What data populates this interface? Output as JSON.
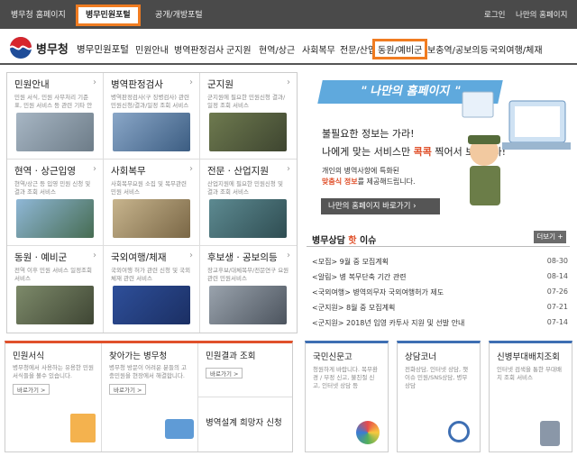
{
  "topbar": {
    "items": [
      "병무청 홈페이지",
      "병무민원포털",
      "공개/개방포털"
    ],
    "right": [
      "로그인",
      "나만의 홈페이지"
    ]
  },
  "header": {
    "logo_text": "병무청",
    "portal": "병무민원포털",
    "nav": [
      "민원안내",
      "병역판정검사",
      "군지원",
      "현역/상근",
      "사회복무",
      "전문/산업",
      "동원/예비군",
      "보충역/공보의등",
      "국외여행/체재"
    ]
  },
  "tiles": [
    {
      "title": "민원안내",
      "desc": "민원 서식, 민원 사무처리 기준표, 민원 서비스 등 관련 기타 안내"
    },
    {
      "title": "병역판정검사",
      "desc": "병역판정검사(구 징병검사) 관련 민원신청/결과/일정 조회 서비스"
    },
    {
      "title": "군지원",
      "desc": "군지원에 필요한 민원신청 결과/일정 조회 서비스"
    },
    {
      "title": "현역 · 상근입영",
      "desc": "현역/상근 등 입영 민원 신청 및 결과 조회 서비스"
    },
    {
      "title": "사회복무",
      "desc": "사회복무요원 소집 및 복무관련 민원 서비스"
    },
    {
      "title": "전문 · 산업지원",
      "desc": "산업지원에 필요한 민원신청 및 결과 조회 서비스"
    },
    {
      "title": "동원 · 예비군",
      "desc": "전역 이후 민원 서비스 일정조회 서비스"
    },
    {
      "title": "국외여행/체재",
      "desc": "국외여행 허가 관련 신청 및 국외체재 관련 서비스"
    },
    {
      "title": "후보생 · 공보의등",
      "desc": "장교후보/대체복무/전문연구 요원 관련 민원서비스"
    }
  ],
  "promo": {
    "ribbon": "\" 나만의 홈페이지 \"",
    "line1": "불필요한 정보는 가라!",
    "line2_a": "나에게 맞는 서비스만",
    "line2_b": "콕콕",
    "line2_c": "찍어서 보여준다!",
    "line3": "개인의 병역사항에 특화된",
    "line4_a": "맞춤식 정보",
    "line4_b": "를 제공해드립니다.",
    "button": "나만의 홈페이지 바로가기"
  },
  "issues": {
    "heading_a": "병무상담",
    "heading_b": "핫",
    "heading_c": "이슈",
    "more": "더보기 +",
    "items": [
      {
        "text": "<모집> 9월 중 모집계획",
        "date": "08-30"
      },
      {
        "text": "<알림> 병 복무단축 기간 관련",
        "date": "08-14"
      },
      {
        "text": "<국외여행> 병역의무자 국외여행허가 제도",
        "date": "07-26"
      },
      {
        "text": "<군지원> 8월 중 모집계획",
        "date": "07-21"
      },
      {
        "text": "<군지원> 2018년 입영 카투사 지원 및 선발 안내",
        "date": "07-14"
      }
    ]
  },
  "bottom": {
    "cards": [
      {
        "title": "민원서식",
        "desc": "병무청에서 사용하는 유용한 민원서식들을 볼수 있습니다.",
        "btn": "바로가기 >"
      },
      {
        "title": "찾아가는 병무청",
        "desc": "병무청 방문이 어려운 분들의 고충민원을 현장에서 해결합니다.",
        "btn": "바로가기 >"
      },
      {
        "title": "민원결과 조회",
        "btn": "바로가기 >"
      },
      {
        "title": "병역설계 희망자 신청"
      }
    ],
    "right": [
      {
        "title": "국민신문고",
        "desc": "청원하게 바랍니다. 복무환경 / 부정 신고, 불친절 신고, 인터넷 상담 등"
      },
      {
        "title": "상담코너",
        "desc": "전화상담, 인터넷 상담, 챗이슈 민원/SNS상담, 병무상담"
      },
      {
        "title": "신병부대배치조회",
        "desc": "인터넷 검색을 통한 부대배치 조회 서비스"
      }
    ]
  },
  "colors": {
    "highlight": "#f07c21",
    "topbar": "#4a4a4a",
    "accent_red": "#e0512b",
    "accent_blue": "#3e6fb3"
  }
}
